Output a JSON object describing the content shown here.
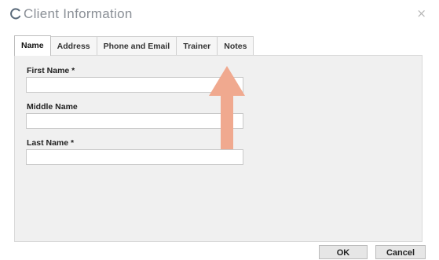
{
  "window": {
    "title": "Client Information",
    "close_glyph": "×",
    "icon": "refresh-icon"
  },
  "tabs": [
    {
      "label": "Name",
      "active": true
    },
    {
      "label": "Address",
      "active": false
    },
    {
      "label": "Phone and Email",
      "active": false
    },
    {
      "label": "Trainer",
      "active": false
    },
    {
      "label": "Notes",
      "active": false
    }
  ],
  "form": {
    "first_name": {
      "label": "First Name *",
      "value": ""
    },
    "middle_name": {
      "label": "Middle Name",
      "value": ""
    },
    "last_name": {
      "label": "Last Name *",
      "value": ""
    }
  },
  "annotation": {
    "icon": "arrow-up-icon",
    "color": "#f0a98f"
  },
  "buttons": {
    "ok_label": "OK",
    "cancel_label": "Cancel"
  }
}
